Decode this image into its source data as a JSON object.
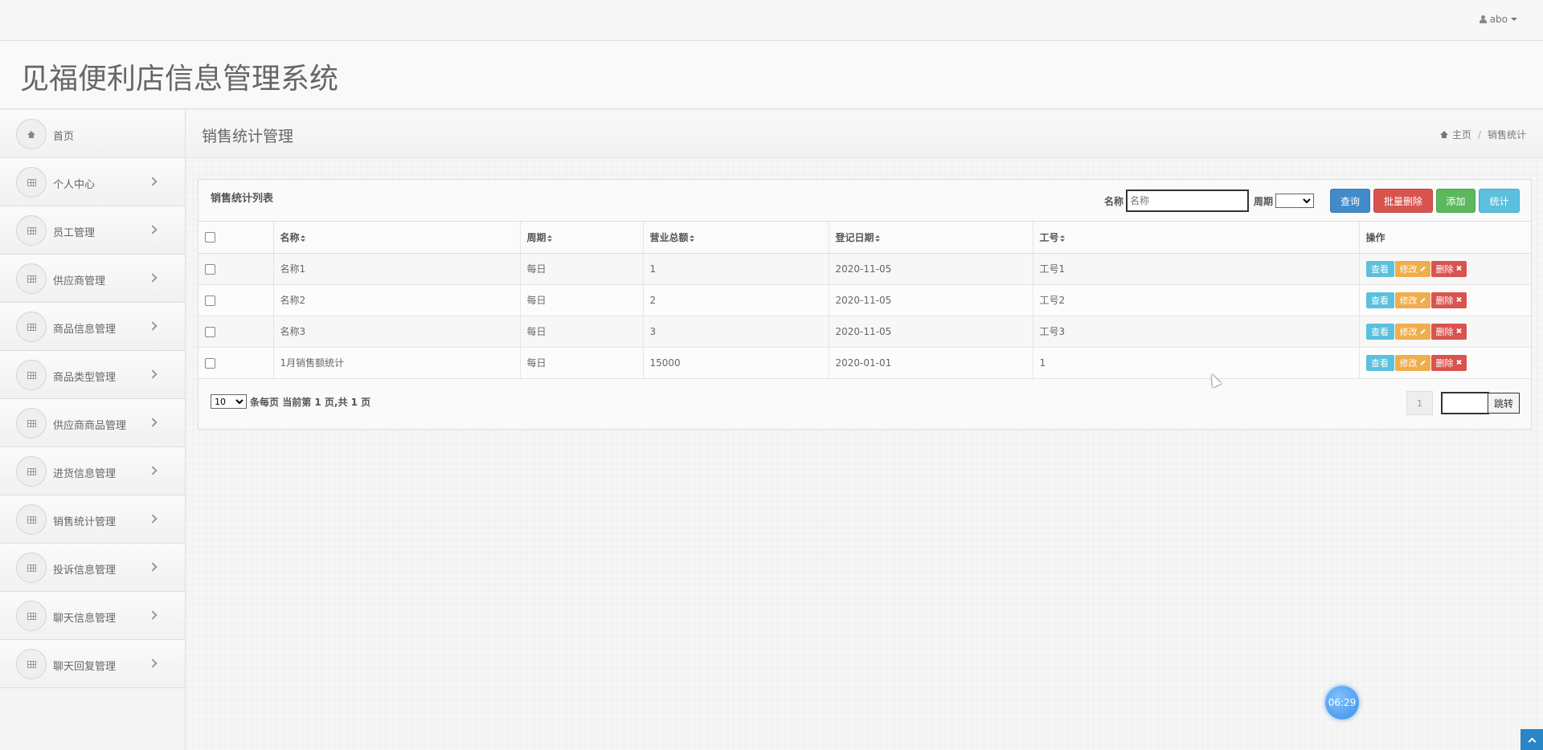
{
  "topbar": {
    "user_name": "abo"
  },
  "header": {
    "app_title": "见福便利店信息管理系统"
  },
  "sidebar": {
    "items": [
      {
        "label": "首页",
        "icon": "home-icon",
        "has_chevron": false
      },
      {
        "label": "个人中心",
        "icon": "table-icon",
        "has_chevron": true
      },
      {
        "label": "员工管理",
        "icon": "table-icon",
        "has_chevron": true
      },
      {
        "label": "供应商管理",
        "icon": "table-icon",
        "has_chevron": true
      },
      {
        "label": "商品信息管理",
        "icon": "table-icon",
        "has_chevron": true
      },
      {
        "label": "商品类型管理",
        "icon": "table-icon",
        "has_chevron": true
      },
      {
        "label": "供应商商品管理",
        "icon": "table-icon",
        "has_chevron": true
      },
      {
        "label": "进货信息管理",
        "icon": "table-icon",
        "has_chevron": true
      },
      {
        "label": "销售统计管理",
        "icon": "table-icon",
        "has_chevron": true
      },
      {
        "label": "投诉信息管理",
        "icon": "table-icon",
        "has_chevron": true
      },
      {
        "label": "聊天信息管理",
        "icon": "table-icon",
        "has_chevron": true
      },
      {
        "label": "聊天回复管理",
        "icon": "table-icon",
        "has_chevron": true
      }
    ]
  },
  "page": {
    "title": "销售统计管理",
    "breadcrumb": {
      "home": "主页",
      "current": "销售统计"
    }
  },
  "panel": {
    "title": "销售统计列表",
    "search": {
      "name_label": "名称",
      "name_placeholder": "名称",
      "period_label": "周期",
      "period_value": ""
    },
    "buttons": {
      "query": "查询",
      "batch_delete": "批量删除",
      "add": "添加",
      "stats": "统计"
    },
    "columns": [
      "名称",
      "周期",
      "营业总额",
      "登记日期",
      "工号",
      "操作"
    ],
    "rows": [
      {
        "name": "名称1",
        "period": "每日",
        "total": "1",
        "date": "2020-11-05",
        "emp_no": "工号1"
      },
      {
        "name": "名称2",
        "period": "每日",
        "total": "2",
        "date": "2020-11-05",
        "emp_no": "工号2"
      },
      {
        "name": "名称3",
        "period": "每日",
        "total": "3",
        "date": "2020-11-05",
        "emp_no": "工号3"
      },
      {
        "name": "1月销售额统计",
        "period": "每日",
        "total": "15000",
        "date": "2020-01-01",
        "emp_no": "1"
      }
    ],
    "row_actions": {
      "view": "查看",
      "edit": "修改",
      "delete": "删除"
    },
    "pager": {
      "page_size": "10",
      "page_size_suffix": "条每页",
      "status": "当前第 1 页,共 1 页",
      "page_number": "1",
      "jump_label": "跳转"
    }
  },
  "timer": {
    "text": "06:29"
  },
  "colors": {
    "primary": "#428bca",
    "danger": "#d9534f",
    "success": "#5cb85c",
    "info": "#5bc0de",
    "warning": "#f0ad4e"
  }
}
